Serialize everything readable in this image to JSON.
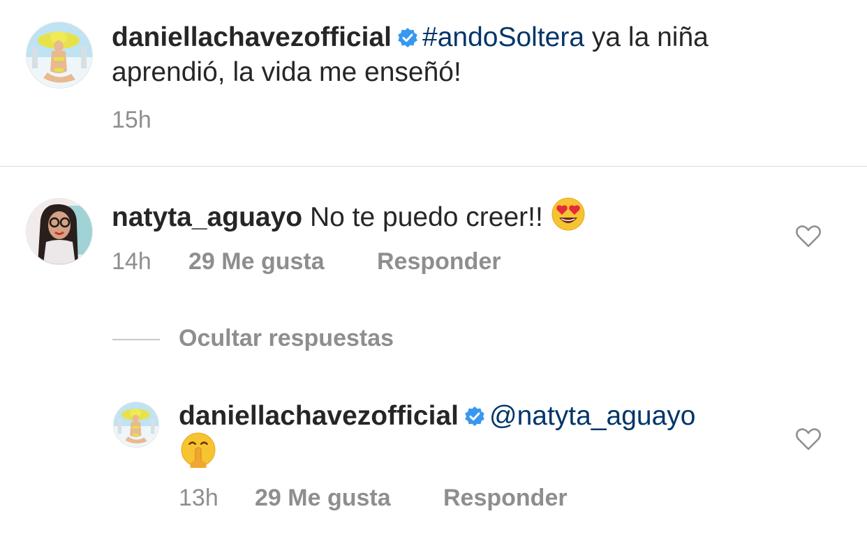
{
  "caption": {
    "username": "daniellachavezofficial",
    "hashtag": "#andoSoltera",
    "text_line1_rest": "ya la niña",
    "text_line2": "aprendió, la vida me enseñó!",
    "time": "15h"
  },
  "comment": {
    "username": "natyta_aguayo",
    "text": "No te puedo creer!!",
    "emoji": "heart-eyes-emoji",
    "time": "14h",
    "likes": "29 Me gusta",
    "reply_label": "Responder"
  },
  "replies_toggle": {
    "label": "Ocultar respuestas"
  },
  "reply": {
    "username": "daniellachavezofficial",
    "mention": "@natyta_aguayo",
    "emoji": "shushing-face-emoji",
    "time": "13h",
    "likes": "29 Me gusta",
    "reply_label": "Responder"
  },
  "icons": {
    "verified": "verified-badge-icon",
    "like": "heart-outline-icon"
  },
  "colors": {
    "username": "#262626",
    "link": "#003569",
    "meta": "#8e8e8e",
    "verified": "#3897f0",
    "divider": "#dbdbdb"
  }
}
